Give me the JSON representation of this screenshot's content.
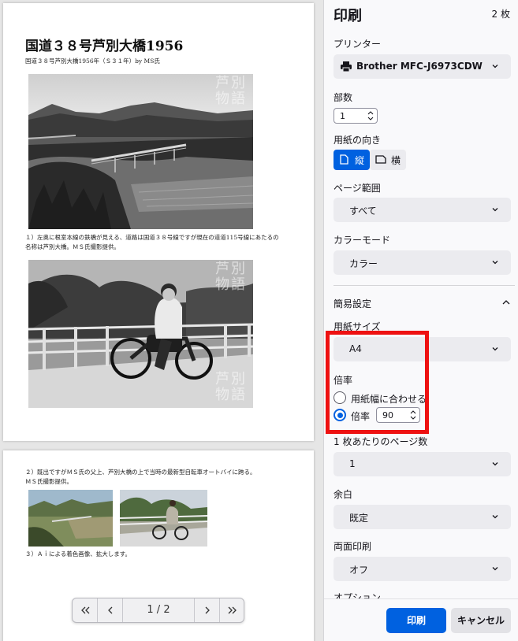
{
  "dialog": {
    "title": "印刷",
    "sheet_count": "2 枚"
  },
  "printer": {
    "label": "プリンター",
    "value": "Brother MFC-J6973CDW"
  },
  "copies": {
    "label": "部数",
    "value": "1"
  },
  "orientation": {
    "label": "用紙の向き",
    "portrait": "縦",
    "landscape": "横",
    "selected": "portrait"
  },
  "page_range": {
    "label": "ページ範囲",
    "value": "すべて"
  },
  "color_mode": {
    "label": "カラーモード",
    "value": "カラー"
  },
  "simple_settings": {
    "label": "簡易設定"
  },
  "paper_size": {
    "label": "用紙サイズ",
    "value": "A4"
  },
  "scale": {
    "label": "倍率",
    "fit_option": "用紙幅に合わせる",
    "custom_option": "倍率",
    "custom_value": "90",
    "selected": "custom"
  },
  "pages_per_sheet": {
    "label": "1 枚あたりのページ数",
    "value": "1"
  },
  "margins": {
    "label": "余白",
    "value": "既定"
  },
  "duplex": {
    "label": "両面印刷",
    "value": "オフ"
  },
  "options": {
    "label": "オプション"
  },
  "actions": {
    "print": "印刷",
    "cancel": "キャンセル"
  },
  "preview": {
    "page1": {
      "title": "国道３８号芦別大橋1956",
      "subtitle": "国道３８号芦別大橋1956年（Ｓ３１年）by MS氏",
      "caption1_line1": "１）左奥に根室本線の鉄橋が見える、道路は国道３８号線ですが現在の道道115号線にあたるの",
      "caption1_line2": "名称は芦別大橋。ＭＳ氏撮影提供。",
      "watermark": "芦別物語"
    },
    "page2": {
      "caption2_line1": "２）既出ですがＭＳ氏の父上、芦別大橋の上で当時の最新型自転車オートバイに跨る。",
      "caption2_line2": "ＭＳ氏撮影提供。",
      "caption3": "３）Ａｉによる着色画像、拡大します。"
    },
    "pager": {
      "page_indicator": "1 / 2"
    }
  },
  "colors": {
    "accent": "#0061e0",
    "highlight": "#ee1111"
  }
}
